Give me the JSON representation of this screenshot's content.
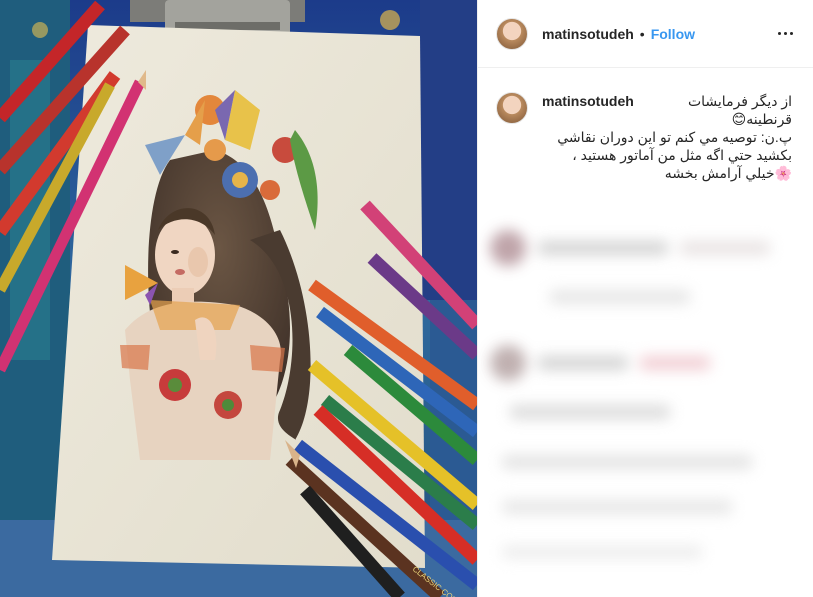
{
  "header": {
    "username": "matinsotudeh",
    "separator": "•",
    "follow_label": "Follow"
  },
  "caption": {
    "username": "matinsotudeh",
    "line1": "از دیگر فرمایشات",
    "line2": "قرنطینه😊",
    "line3": "پ.ن: توصیه مي کنم تو این دوران نقاشي",
    "line4": "بکشید حتي اگه مثل من آماتور هستید ،",
    "line5": "🌸خيلي آرامش بخشه"
  },
  "media": {
    "pencil_brand_label": "CLASSIC COLOUR"
  }
}
